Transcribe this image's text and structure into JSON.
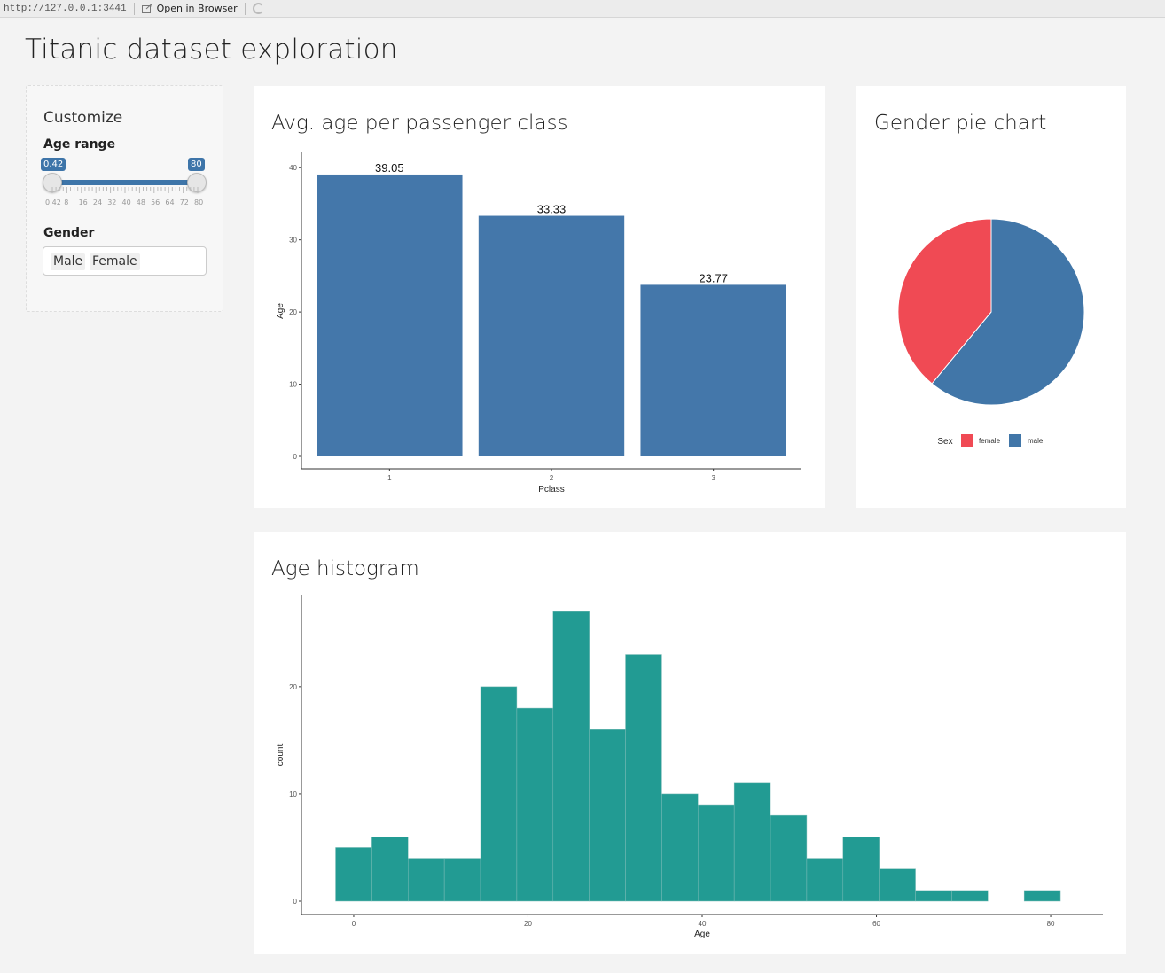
{
  "browser": {
    "url": "http://127.0.0.1:3441",
    "open_label": "Open in Browser"
  },
  "page": {
    "title": "Titanic dataset exploration"
  },
  "sidebar": {
    "heading": "Customize",
    "age_range": {
      "label": "Age range",
      "min": 0.42,
      "max": 80,
      "value_low": 0.42,
      "value_high": 80,
      "low_badge": "0.42",
      "high_badge": "80",
      "tick_labels": [
        "0.42",
        "8",
        "16",
        "24",
        "32",
        "40",
        "48",
        "56",
        "64",
        "72",
        "80"
      ]
    },
    "gender": {
      "label": "Gender",
      "selected": [
        "Male",
        "Female"
      ]
    }
  },
  "colors": {
    "accent": "#3e75a9",
    "bar": "#4477aa",
    "female": "#f04a54",
    "male": "#4176a8",
    "hist": "#229b93"
  },
  "cards": {
    "bar": {
      "title": "Avg. age per passenger class"
    },
    "pie": {
      "title": "Gender pie chart"
    },
    "hist": {
      "title": "Age histogram"
    }
  },
  "chart_data": [
    {
      "type": "bar",
      "categories": [
        "1",
        "2",
        "3"
      ],
      "values": [
        39.05,
        33.33,
        23.77
      ],
      "data_labels": [
        "39.05",
        "33.33",
        "23.77"
      ],
      "xlabel": "Pclass",
      "ylabel": "Age",
      "ylim": [
        0,
        40
      ],
      "yticks": [
        0,
        10,
        20,
        30,
        40
      ],
      "grid": false
    },
    {
      "type": "pie",
      "legend_title": "Sex",
      "legend_position": "bottom",
      "slices": [
        {
          "name": "female",
          "value": 39
        },
        {
          "name": "male",
          "value": 61
        }
      ]
    },
    {
      "type": "bar",
      "subtype": "histogram",
      "bin_edges": [
        -2.08,
        2.08,
        6.24,
        10.4,
        14.56,
        18.72,
        22.88,
        27.04,
        31.2,
        35.36,
        39.52,
        43.68,
        47.84,
        52.0,
        56.16,
        60.32,
        64.48,
        68.64,
        72.8,
        76.96,
        81.12
      ],
      "counts": [
        5,
        6,
        4,
        4,
        20,
        18,
        27,
        16,
        23,
        10,
        9,
        11,
        8,
        4,
        6,
        3,
        1,
        1,
        0,
        1
      ],
      "xlabel": "Age",
      "ylabel": "count",
      "xlim": [
        -6,
        86
      ],
      "xticks": [
        0,
        20,
        40,
        60,
        80
      ],
      "ylim": [
        0,
        28
      ],
      "yticks": [
        0,
        10,
        20
      ],
      "grid": false
    }
  ]
}
